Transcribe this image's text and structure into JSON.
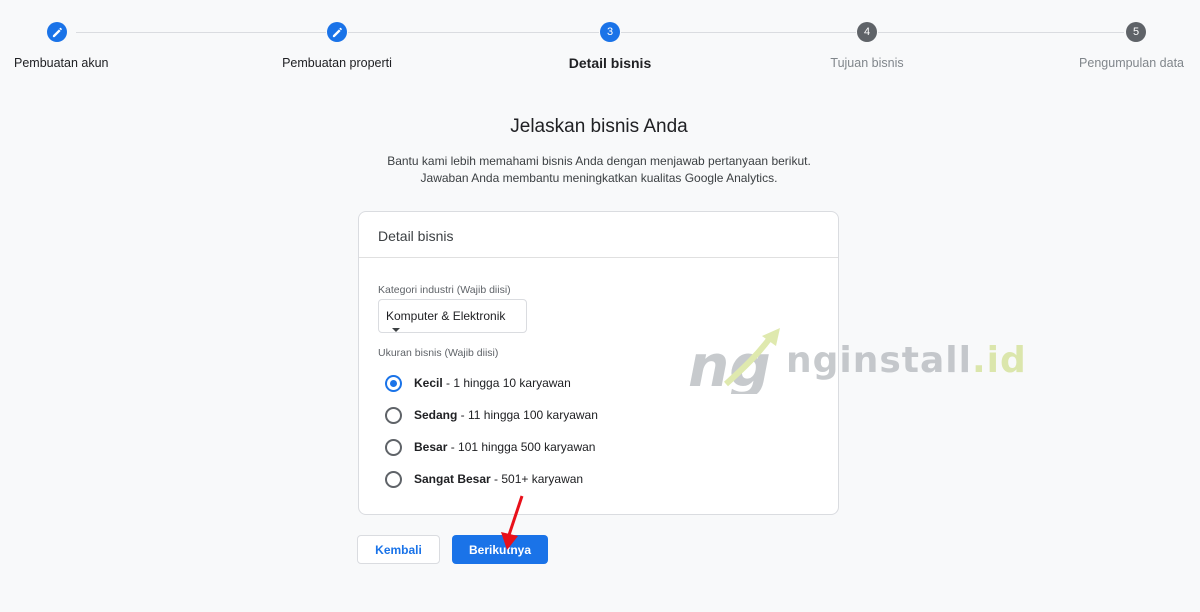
{
  "stepper": {
    "steps": [
      {
        "label": "Pembuatan akun",
        "state": "done",
        "icon": "pencil-icon"
      },
      {
        "label": "Pembuatan properti",
        "state": "done",
        "icon": "pencil-icon"
      },
      {
        "label": "Detail bisnis",
        "state": "active",
        "number": "3"
      },
      {
        "label": "Tujuan bisnis",
        "state": "todo",
        "number": "4"
      },
      {
        "label": "Pengumpulan data",
        "state": "todo",
        "number": "5"
      }
    ]
  },
  "heading": {
    "title": "Jelaskan bisnis Anda",
    "subtitle_line1": "Bantu kami lebih memahami bisnis Anda dengan menjawab pertanyaan berikut.",
    "subtitle_line2": "Jawaban Anda membantu meningkatkan kualitas Google Analytics."
  },
  "card": {
    "header": "Detail bisnis",
    "industry_label": "Kategori industri (Wajib diisi)",
    "industry_value": "Komputer & Elektronik",
    "size_label": "Ukuran bisnis (Wajib diisi)",
    "size_options": [
      {
        "name": "Kecil",
        "desc": " - 1 hingga 10 karyawan",
        "checked": true
      },
      {
        "name": "Sedang",
        "desc": " - 11 hingga 100 karyawan",
        "checked": false
      },
      {
        "name": "Besar",
        "desc": " - 101 hingga 500 karyawan",
        "checked": false
      },
      {
        "name": "Sangat Besar",
        "desc": " - 501+ karyawan",
        "checked": false
      }
    ]
  },
  "buttons": {
    "back": "Kembali",
    "next": "Berikutnya"
  },
  "watermark": {
    "logo_letters": "ng",
    "text_main": "nginstall",
    "text_suffix": ".id"
  },
  "colors": {
    "accent": "#1a73e8",
    "arrow": "#e8101a"
  }
}
